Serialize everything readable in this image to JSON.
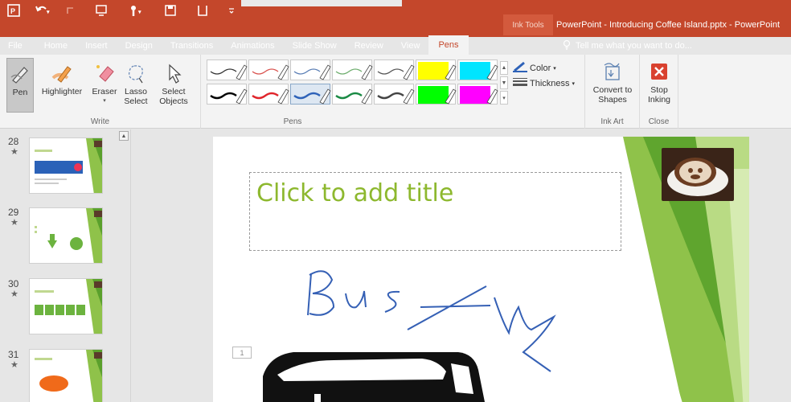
{
  "titlebar": {
    "ink_tools_label": "Ink Tools",
    "document_title": "PowerPoint - Introducing Coffee Island.pptx - PowerPoint"
  },
  "tabs": [
    "File",
    "Home",
    "Insert",
    "Design",
    "Transitions",
    "Animations",
    "Slide Show",
    "Review",
    "View",
    "Pens"
  ],
  "active_tab": "Pens",
  "tell_me": "Tell me what you want to do...",
  "ribbon": {
    "write": {
      "label": "Write",
      "pen": "Pen",
      "highlighter": "Highlighter",
      "eraser": "Eraser",
      "lasso": "Lasso Select",
      "select_objects": "Select Objects"
    },
    "pens": {
      "label": "Pens",
      "swatches": [
        {
          "color": "#333333",
          "kind": "pen"
        },
        {
          "color": "#d9534f",
          "kind": "pen"
        },
        {
          "color": "#5b7fb5",
          "kind": "pen"
        },
        {
          "color": "#6fae6f",
          "kind": "pen"
        },
        {
          "color": "#555555",
          "kind": "pen"
        },
        {
          "color": "#ffff00",
          "kind": "highlighter"
        },
        {
          "color": "#00e5ff",
          "kind": "highlighter"
        },
        {
          "color": "#000000",
          "kind": "pen"
        },
        {
          "color": "#e0252b",
          "kind": "pen"
        },
        {
          "color": "#2e62b8",
          "kind": "pen",
          "selected": true
        },
        {
          "color": "#1a8a44",
          "kind": "pen"
        },
        {
          "color": "#444444",
          "kind": "pen"
        },
        {
          "color": "#00ff00",
          "kind": "highlighter"
        },
        {
          "color": "#ff00ff",
          "kind": "highlighter"
        }
      ],
      "color_label": "Color",
      "thickness_label": "Thickness"
    },
    "ink_art": {
      "label": "Ink Art",
      "convert": "Convert to Shapes"
    },
    "close": {
      "label": "Close",
      "stop": "Stop Inking"
    }
  },
  "thumbnails": [
    {
      "number": "28",
      "star": "★"
    },
    {
      "number": "29",
      "star": "★"
    },
    {
      "number": "30",
      "star": "★"
    },
    {
      "number": "31",
      "star": "★"
    }
  ],
  "slide": {
    "title_placeholder": "Click to add title",
    "slide_number": "1"
  },
  "colors": {
    "accent": "#c4472b",
    "title_green": "#8db82e",
    "ink_blue": "#3560b5"
  }
}
